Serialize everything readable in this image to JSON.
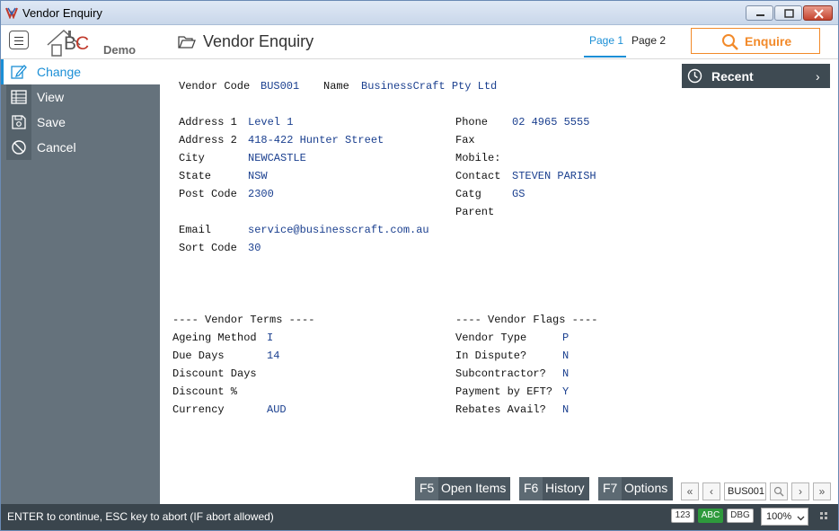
{
  "window": {
    "title": "Vendor Enquiry"
  },
  "header": {
    "logo_b": "B",
    "logo_c": "C",
    "demo_label": "Demo",
    "page_title": "Vendor Enquiry",
    "tabs": [
      "Page 1",
      "Page 2"
    ],
    "enquire_label": "Enquire"
  },
  "sidebar": {
    "items": [
      {
        "label": "Change",
        "icon": "pencil-icon"
      },
      {
        "label": "View",
        "icon": "table-icon"
      },
      {
        "label": "Save",
        "icon": "floppy-icon"
      },
      {
        "label": "Cancel",
        "icon": "cancel-icon"
      }
    ]
  },
  "recent": {
    "label": "Recent",
    "chevron": "›"
  },
  "vendor": {
    "code_label": "Vendor Code",
    "code": "BUS001",
    "name_label": "Name",
    "name": "BusinessCraft Pty Ltd",
    "address1_label": "Address 1",
    "address1": "Level 1",
    "address2_label": "Address 2",
    "address2": "418-422 Hunter Street",
    "city_label": "City",
    "city": "NEWCASTLE",
    "state_label": "State",
    "state": "NSW",
    "postcode_label": "Post Code",
    "postcode": "2300",
    "email_label": "Email",
    "email": "service@businesscraft.com.au",
    "sortcode_label": "Sort Code",
    "sortcode": "30",
    "phone_label": "Phone",
    "phone": "02 4965 5555",
    "fax_label": "Fax",
    "mobile_label": "Mobile:",
    "contact_label": "Contact",
    "contact": "STEVEN PARISH",
    "catg_label": "Catg",
    "catg": "GS",
    "parent_label": "Parent"
  },
  "terms": {
    "heading": "---- Vendor Terms ----",
    "ageing_label": "Ageing Method",
    "ageing": "I",
    "due_label": "Due Days",
    "due": "14",
    "disc_days_label": "Discount Days",
    "disc_pct_label": "Discount %",
    "currency_label": "Currency",
    "currency": "AUD"
  },
  "flags": {
    "heading": "---- Vendor Flags ----",
    "type_label": "Vendor Type",
    "type": "P",
    "dispute_label": "In Dispute?",
    "dispute": "N",
    "subcon_label": "Subcontractor?",
    "subcon": "N",
    "eft_label": "Payment by EFT?",
    "eft": "Y",
    "rebates_label": "Rebates Avail?",
    "rebates": "N"
  },
  "functions": [
    {
      "key": "F5",
      "label": "Open Items"
    },
    {
      "key": "F6",
      "label": "History"
    },
    {
      "key": "F7",
      "label": "Options"
    }
  ],
  "nav": {
    "first": "«",
    "prev": "‹",
    "code": "BUS001",
    "next": "›",
    "last": "»"
  },
  "status": {
    "text": "ENTER to continue, ESC key to abort (IF abort allowed)",
    "ind_123": "123",
    "ind_abc": "ABC",
    "ind_dbg": "DBG",
    "zoom": "100%"
  },
  "colors": {
    "accent": "#1b8fd6",
    "enquire": "#f28a2a",
    "sidebar": "#65727c",
    "statusbar": "#3a454d",
    "value": "#1a3f8f"
  }
}
